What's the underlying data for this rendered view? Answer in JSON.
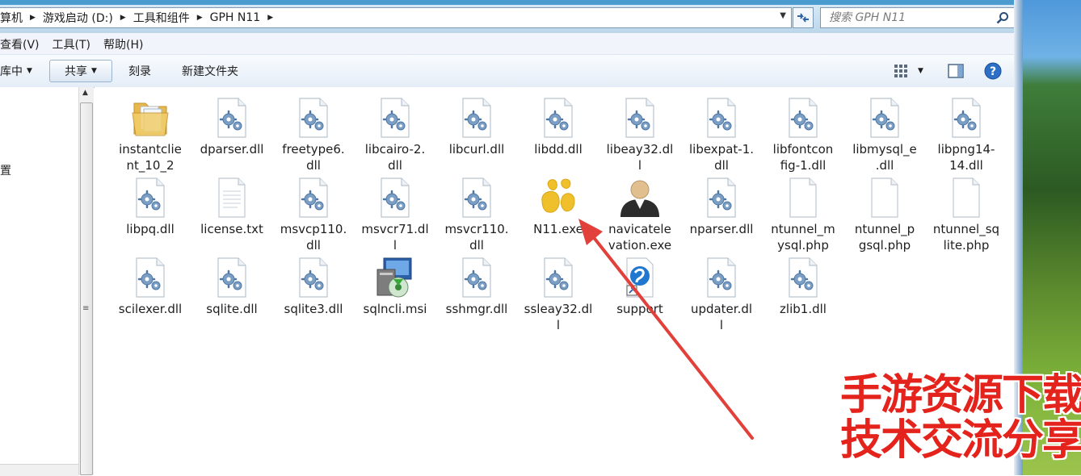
{
  "address": {
    "crumbs": [
      "算机",
      "游戏启动 (D:)",
      "工具和组件",
      "GPH N11"
    ]
  },
  "search": {
    "placeholder": "搜索 GPH N11"
  },
  "menu": {
    "items": [
      "查看(V)",
      "工具(T)",
      "帮助(H)"
    ]
  },
  "toolbar": {
    "include_label": "库中",
    "share_label": "共享",
    "burn_label": "刻录",
    "new_folder_label": "新建文件夹"
  },
  "nav": {
    "partial_item": "置"
  },
  "files": [
    {
      "name": "instantclient_10_2",
      "label": "instantclie\nnt_10_2",
      "icon": "folder-icon"
    },
    {
      "name": "dparser.dll",
      "label": "dparser.dll",
      "icon": "dll-icon"
    },
    {
      "name": "freetype6.dll",
      "label": "freetype6.\ndll",
      "icon": "dll-icon"
    },
    {
      "name": "libcairo-2.dll",
      "label": "libcairo-2.\ndll",
      "icon": "dll-icon"
    },
    {
      "name": "libcurl.dll",
      "label": "libcurl.dll",
      "icon": "dll-icon"
    },
    {
      "name": "libdd.dll",
      "label": "libdd.dll",
      "icon": "dll-icon"
    },
    {
      "name": "libeay32.dll",
      "label": "libeay32.dl\nl",
      "icon": "dll-icon"
    },
    {
      "name": "libexpat-1.dll",
      "label": "libexpat-1.\ndll",
      "icon": "dll-icon"
    },
    {
      "name": "libfontconfig-1.dll",
      "label": "libfontcon\nfig-1.dll",
      "icon": "dll-icon"
    },
    {
      "name": "libmysql_e.dll",
      "label": "libmysql_e\n.dll",
      "icon": "dll-icon"
    },
    {
      "name": "libpng14-14.dll",
      "label": "libpng14-\n14.dll",
      "icon": "dll-icon"
    },
    {
      "name": "libpq.dll",
      "label": "libpq.dll",
      "icon": "dll-icon"
    },
    {
      "name": "license.txt",
      "label": "license.txt",
      "icon": "text-file-icon"
    },
    {
      "name": "msvcp110.dll",
      "label": "msvcp110.\ndll",
      "icon": "dll-icon"
    },
    {
      "name": "msvcr71.dll",
      "label": "msvcr71.dl\nl",
      "icon": "dll-icon"
    },
    {
      "name": "msvcr110.dll",
      "label": "msvcr110.\ndll",
      "icon": "dll-icon"
    },
    {
      "name": "N11.exe",
      "label": "N11.exe",
      "icon": "n11-app-icon"
    },
    {
      "name": "navicatelevation.exe",
      "label": "navicatele\nvation.exe",
      "icon": "user-avatar-icon"
    },
    {
      "name": "nparser.dll",
      "label": "nparser.dll",
      "icon": "dll-icon"
    },
    {
      "name": "ntunnel_mysql.php",
      "label": "ntunnel_m\nysql.php",
      "icon": "blank-file-icon"
    },
    {
      "name": "ntunnel_pgsql.php",
      "label": "ntunnel_p\ngsql.php",
      "icon": "blank-file-icon"
    },
    {
      "name": "ntunnel_sqlite.php",
      "label": "ntunnel_sq\nlite.php",
      "icon": "blank-file-icon"
    },
    {
      "name": "scilexer.dll",
      "label": "scilexer.dll",
      "icon": "dll-icon"
    },
    {
      "name": "sqlite.dll",
      "label": "sqlite.dll",
      "icon": "dll-icon"
    },
    {
      "name": "sqlite3.dll",
      "label": "sqlite3.dll",
      "icon": "dll-icon"
    },
    {
      "name": "sqlncli.msi",
      "label": "sqlncli.msi",
      "icon": "installer-icon"
    },
    {
      "name": "sshmgr.dll",
      "label": "sshmgr.dll",
      "icon": "dll-icon"
    },
    {
      "name": "ssleay32.dll",
      "label": "ssleay32.dl\nl",
      "icon": "dll-icon"
    },
    {
      "name": "support",
      "label": "support",
      "icon": "support-link-icon"
    },
    {
      "name": "updater.dll",
      "label": "updater.dl\nl",
      "icon": "dll-icon"
    },
    {
      "name": "zlib1.dll",
      "label": "zlib1.dll",
      "icon": "dll-icon"
    }
  ],
  "watermark": {
    "line1": "手游资源下载",
    "line2": "技术交流分享"
  },
  "colors": {
    "arrow": "#e2403a",
    "watermark": "#e4241c"
  }
}
